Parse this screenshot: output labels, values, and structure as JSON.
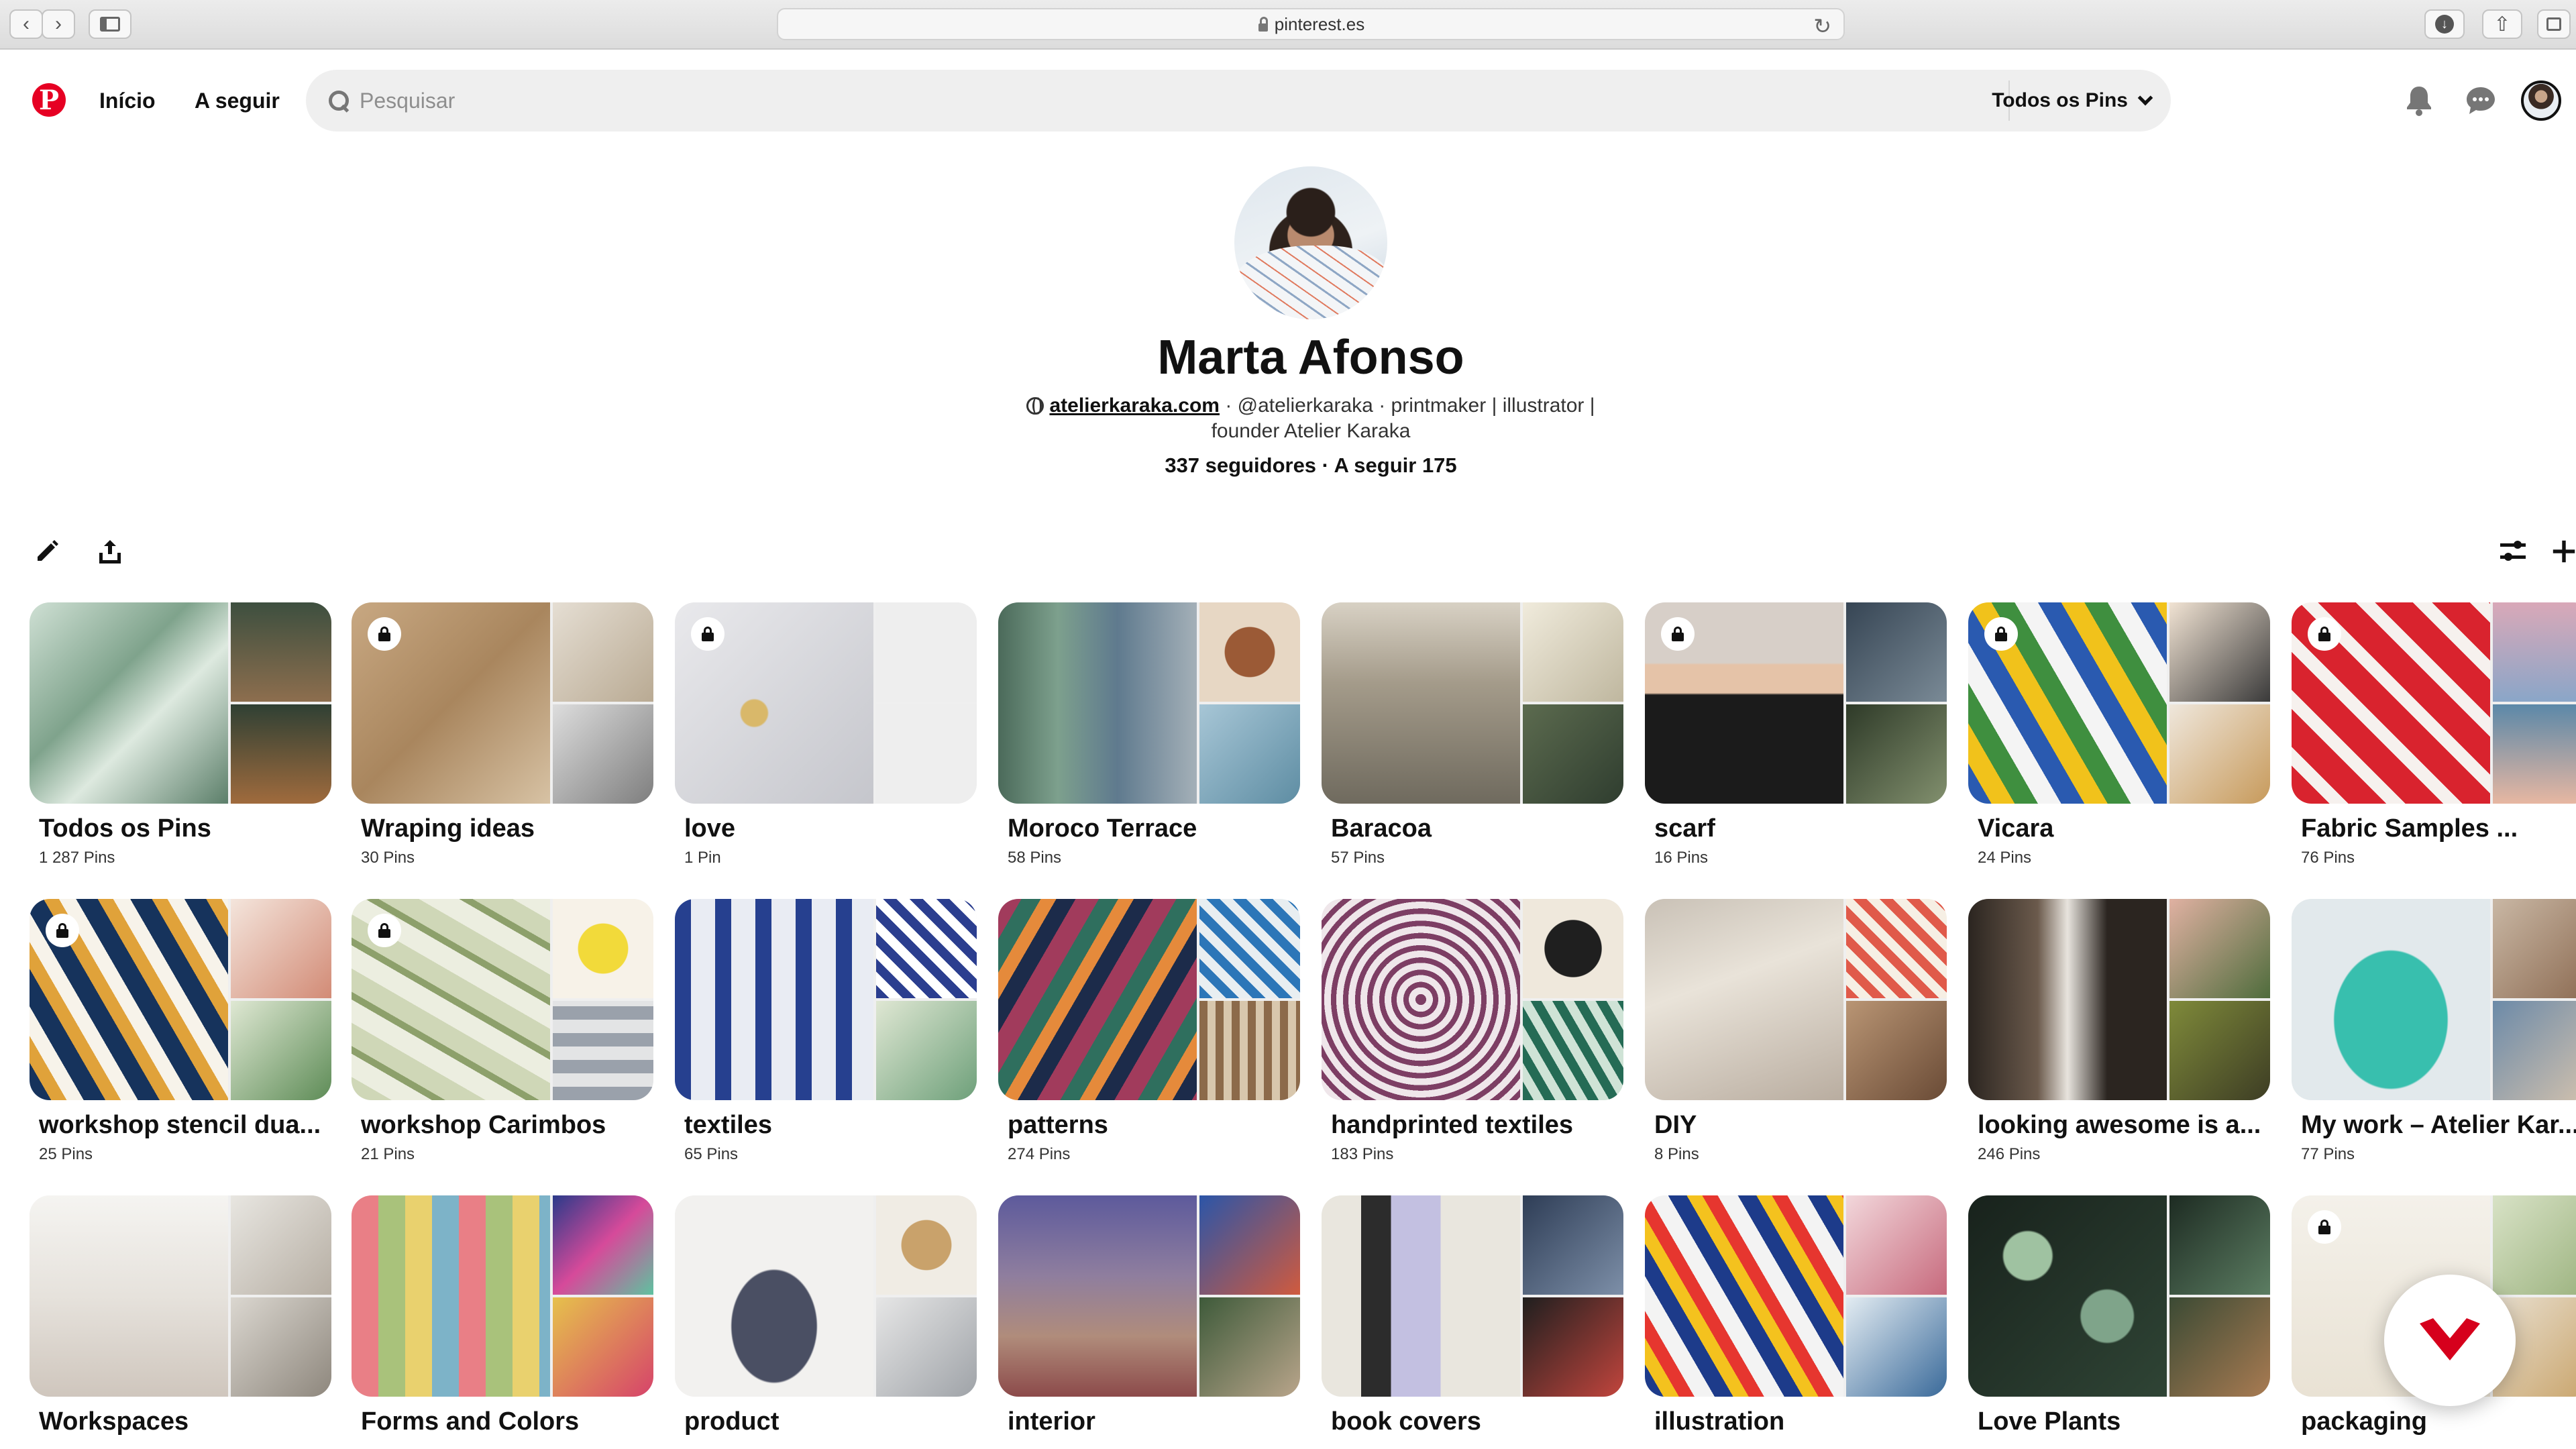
{
  "browser": {
    "url": "pinterest.es"
  },
  "nav": {
    "home": "Início",
    "following": "A seguir"
  },
  "search": {
    "placeholder": "Pesquisar",
    "scope": "Todos os Pins"
  },
  "profile": {
    "name": "Marta Afonso",
    "website": "atelierkaraka.com",
    "bio_line1": "· @atelierkaraka · printmaker | illustrator |",
    "bio_line2": "founder Atelier Karaka",
    "stats": "337 seguidores · A seguir 175"
  },
  "colors": {
    "brand": "#e60023",
    "search_bg": "#efefef"
  },
  "boards": [
    {
      "title": "Todos os Pins",
      "count": "1 287 Pins",
      "locked": false
    },
    {
      "title": "Wraping ideas",
      "count": "30 Pins",
      "locked": true
    },
    {
      "title": "love",
      "count": "1 Pin",
      "locked": true
    },
    {
      "title": "Moroco Terrace",
      "count": "58 Pins",
      "locked": false
    },
    {
      "title": "Baracoa",
      "count": "57 Pins",
      "locked": false
    },
    {
      "title": "scarf",
      "count": "16 Pins",
      "locked": true
    },
    {
      "title": "Vicara",
      "count": "24 Pins",
      "locked": true
    },
    {
      "title": "Fabric Samples ...",
      "count": "76 Pins",
      "locked": true
    },
    {
      "title": "workshop stencil dua...",
      "count": "25 Pins",
      "locked": true
    },
    {
      "title": "workshop Carimbos",
      "count": "21 Pins",
      "locked": true
    },
    {
      "title": "textiles",
      "count": "65 Pins",
      "locked": false
    },
    {
      "title": "patterns",
      "count": "274 Pins",
      "locked": false
    },
    {
      "title": "handprinted textiles",
      "count": "183 Pins",
      "locked": false
    },
    {
      "title": "DIY",
      "count": "8 Pins",
      "locked": false
    },
    {
      "title": "looking awesome is a...",
      "count": "246 Pins",
      "locked": false
    },
    {
      "title": "My work – Atelier Kar...",
      "count": "77 Pins",
      "locked": false
    },
    {
      "title": "Workspaces",
      "count": "",
      "locked": false
    },
    {
      "title": "Forms and Colors",
      "count": "",
      "locked": false
    },
    {
      "title": "product",
      "count": "",
      "locked": false
    },
    {
      "title": "interior",
      "count": "",
      "locked": false
    },
    {
      "title": "book covers",
      "count": "",
      "locked": false
    },
    {
      "title": "illustration",
      "count": "",
      "locked": false
    },
    {
      "title": "Love Plants",
      "count": "",
      "locked": false
    },
    {
      "title": "packaging",
      "count": "",
      "locked": true
    }
  ]
}
